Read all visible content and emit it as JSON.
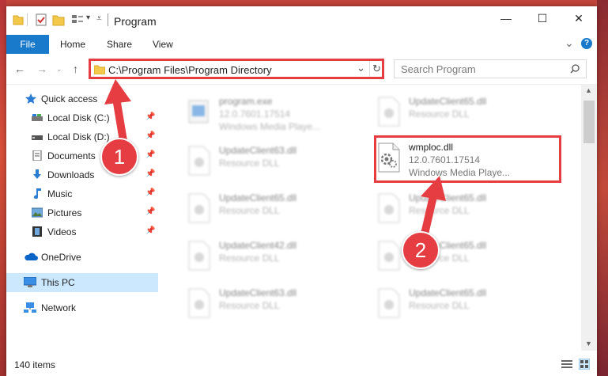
{
  "window": {
    "title": "Program",
    "controls": {
      "minimize": "—",
      "maximize": "☐",
      "close": "✕"
    }
  },
  "ribbon": {
    "tabs": [
      "File",
      "Home",
      "Share",
      "View"
    ],
    "expand": "⌄",
    "help": "?"
  },
  "address_bar": {
    "path": "C:\\Program Files\\Program Directory",
    "dropdown": "⌄",
    "refresh": "↻"
  },
  "search": {
    "placeholder": "Search Program"
  },
  "navigation": {
    "items": [
      {
        "label": "Quick access",
        "pinned": false
      },
      {
        "label": "Local Disk (C:)",
        "pinned": true
      },
      {
        "label": "Local Disk (D:)",
        "pinned": true
      },
      {
        "label": "Documents",
        "pinned": true
      },
      {
        "label": "Downloads",
        "pinned": true
      },
      {
        "label": "Music",
        "pinned": true
      },
      {
        "label": "Pictures",
        "pinned": true
      },
      {
        "label": "Videos",
        "pinned": true
      },
      {
        "label": "OneDrive",
        "pinned": false
      },
      {
        "label": "This PC",
        "pinned": false,
        "selected": true
      },
      {
        "label": "Network",
        "pinned": false
      }
    ],
    "pin_glyph": "📌"
  },
  "files": [
    {
      "name": "program.exe",
      "line1": "12.0.7601.17514",
      "line2": "Windows Media Playe...",
      "blurred": true
    },
    {
      "name": "UpdateClient65.dll",
      "line1": "Resource DLL",
      "line2": "",
      "blurred": true
    },
    {
      "name": "UpdateClient63.dll",
      "line1": "Resource DLL",
      "line2": "",
      "blurred": true
    },
    {
      "name": "wmploc.dll",
      "line1": "12.0.7601.17514",
      "line2": "Windows Media Playe...",
      "blurred": false
    },
    {
      "name": "UpdateClient65.dll",
      "line1": "Resource DLL",
      "line2": "",
      "blurred": true
    },
    {
      "name": "UpdateClient65.dll",
      "line1": "Resource DLL",
      "line2": "",
      "blurred": true
    },
    {
      "name": "UpdateClient42.dll",
      "line1": "Resource DLL",
      "line2": "",
      "blurred": true
    },
    {
      "name": "UpdateClient65.dll",
      "line1": "Resource DLL",
      "line2": "",
      "blurred": true
    },
    {
      "name": "UpdateClient63.dll",
      "line1": "Resource DLL",
      "line2": "",
      "blurred": true
    },
    {
      "name": "UpdateClient65.dll",
      "line1": "Resource DLL",
      "line2": "",
      "blurred": true
    }
  ],
  "annotations": {
    "step1": "1",
    "step2": "2",
    "color": "#e53d42"
  },
  "status_bar": {
    "count": "140 items"
  },
  "colors": {
    "accent": "#1979ca",
    "selection": "#cce8ff",
    "highlight": "#e53d42"
  }
}
